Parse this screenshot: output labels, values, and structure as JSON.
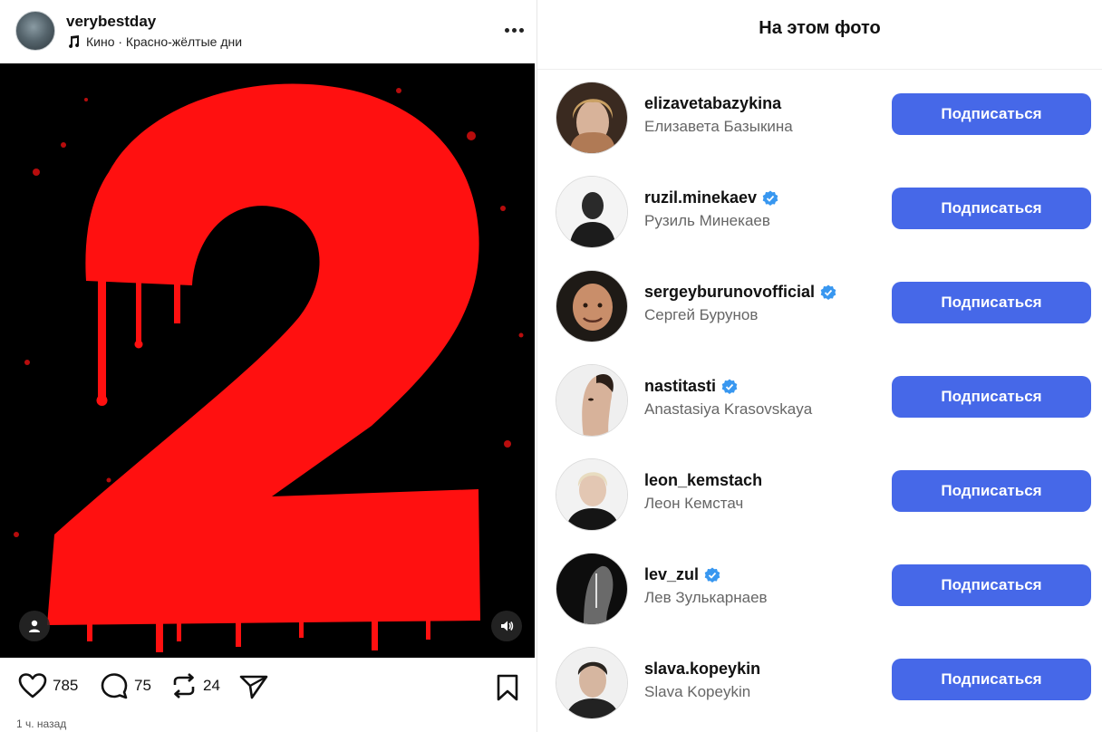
{
  "post": {
    "username": "verybestday",
    "music": "Кино · Красно-жёлтые дни",
    "likes": "785",
    "comments": "75",
    "reposts": "24",
    "time": "1 ч. назад",
    "media_glyph": "2",
    "icons": {
      "music": "music-note-icon",
      "more": "more-horizontal-icon",
      "tag": "person-tag-icon",
      "sound": "speaker-icon",
      "like": "heart-icon",
      "comment": "comment-icon",
      "repost": "repost-icon",
      "share": "send-icon",
      "save": "bookmark-icon"
    }
  },
  "tagged": {
    "title": "На этом фото",
    "follow_label": "Подписаться",
    "accent_color": "#4668e8",
    "verified_color": "#3897f0",
    "people": [
      {
        "username": "elizavetabazykina",
        "name": "Елизавета Базыкина",
        "verified": false
      },
      {
        "username": "ruzil.minekaev",
        "name": "Рузиль Минекаев",
        "verified": true
      },
      {
        "username": "sergeyburunovofficial",
        "name": "Сергей Бурунов",
        "verified": true
      },
      {
        "username": "nastitasti",
        "name": "Anastasiya Krasovskaya",
        "verified": true
      },
      {
        "username": "leon_kemstach",
        "name": "Леон Кемстач",
        "verified": false
      },
      {
        "username": "lev_zul",
        "name": "Лев Зулькарнаев",
        "verified": true
      },
      {
        "username": "slava.kopeykin",
        "name": "Slava Kopeykin",
        "verified": false
      }
    ]
  }
}
